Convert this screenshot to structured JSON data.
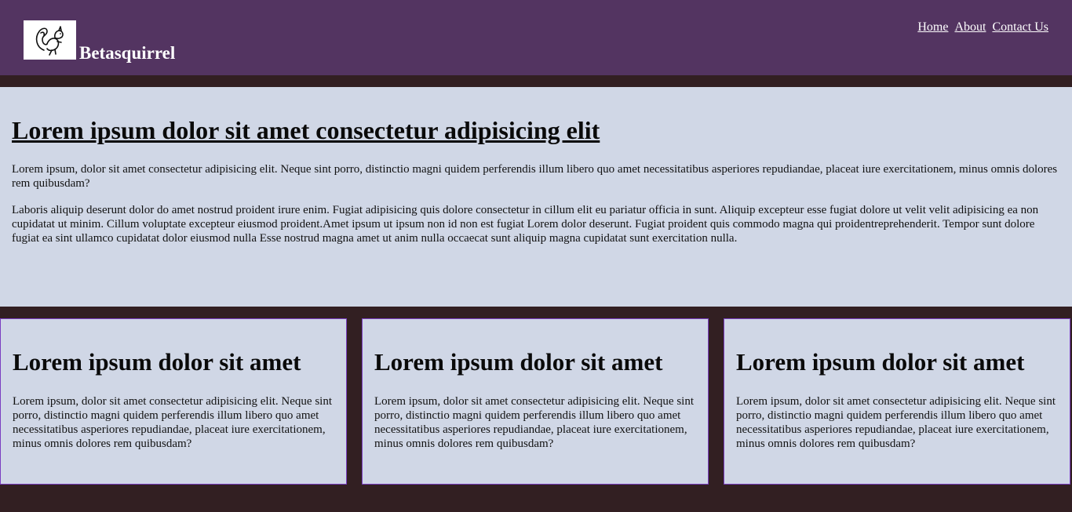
{
  "header": {
    "brand": "Betasquirrel",
    "logo_icon": "squirrel-logo-icon",
    "nav": [
      "Home",
      "About",
      "Contact Us"
    ]
  },
  "hero": {
    "title": "Lorem ipsum dolor sit amet consectetur adipisicing elit",
    "paragraphs": [
      "Lorem ipsum, dolor sit amet consectetur adipisicing elit. Neque sint porro, distinctio magni quidem perferendis illum libero quo amet necessitatibus asperiores repudiandae, placeat iure exercitationem, minus omnis dolores rem quibusdam?",
      "Laboris aliquip deserunt dolor do amet nostrud proident irure enim. Fugiat adipisicing quis dolore consectetur in cillum elit eu pariatur officia in sunt. Aliquip excepteur esse fugiat dolore ut velit velit adipisicing ea non cupidatat ut minim. Cillum voluptate excepteur eiusmod proident.Amet ipsum ut ipsum non id non est fugiat Lorem dolor deserunt. Fugiat proident quis commodo magna qui proidentreprehenderit. Tempor sunt dolore fugiat ea sint ullamco cupidatat dolor eiusmod nulla Esse nostrud magna amet ut anim nulla occaecat sunt aliquip magna cupidatat sunt exercitation nulla."
    ]
  },
  "cards": [
    {
      "title": "Lorem ipsum dolor sit amet",
      "text": "Lorem ipsum, dolor sit amet consectetur adipisicing elit. Neque sint porro, distinctio magni quidem perferendis illum libero quo amet necessitatibus asperiores repudiandae, placeat iure exercitationem, minus omnis dolores rem quibusdam?"
    },
    {
      "title": "Lorem ipsum dolor sit amet",
      "text": "Lorem ipsum, dolor sit amet consectetur adipisicing elit. Neque sint porro, distinctio magni quidem perferendis illum libero quo amet necessitatibus asperiores repudiandae, placeat iure exercitationem, minus omnis dolores rem quibusdam?"
    },
    {
      "title": "Lorem ipsum dolor sit amet",
      "text": "Lorem ipsum, dolor sit amet consectetur adipisicing elit. Neque sint porro, distinctio magni quidem perferendis illum libero quo amet necessitatibus asperiores repudiandae, placeat iure exercitationem, minus omnis dolores rem quibusdam?"
    }
  ],
  "colors": {
    "header_bg": "#533461",
    "page_bg": "#321f22",
    "panel_bg": "#d0d7e6",
    "card_border": "#7a3fc2"
  }
}
